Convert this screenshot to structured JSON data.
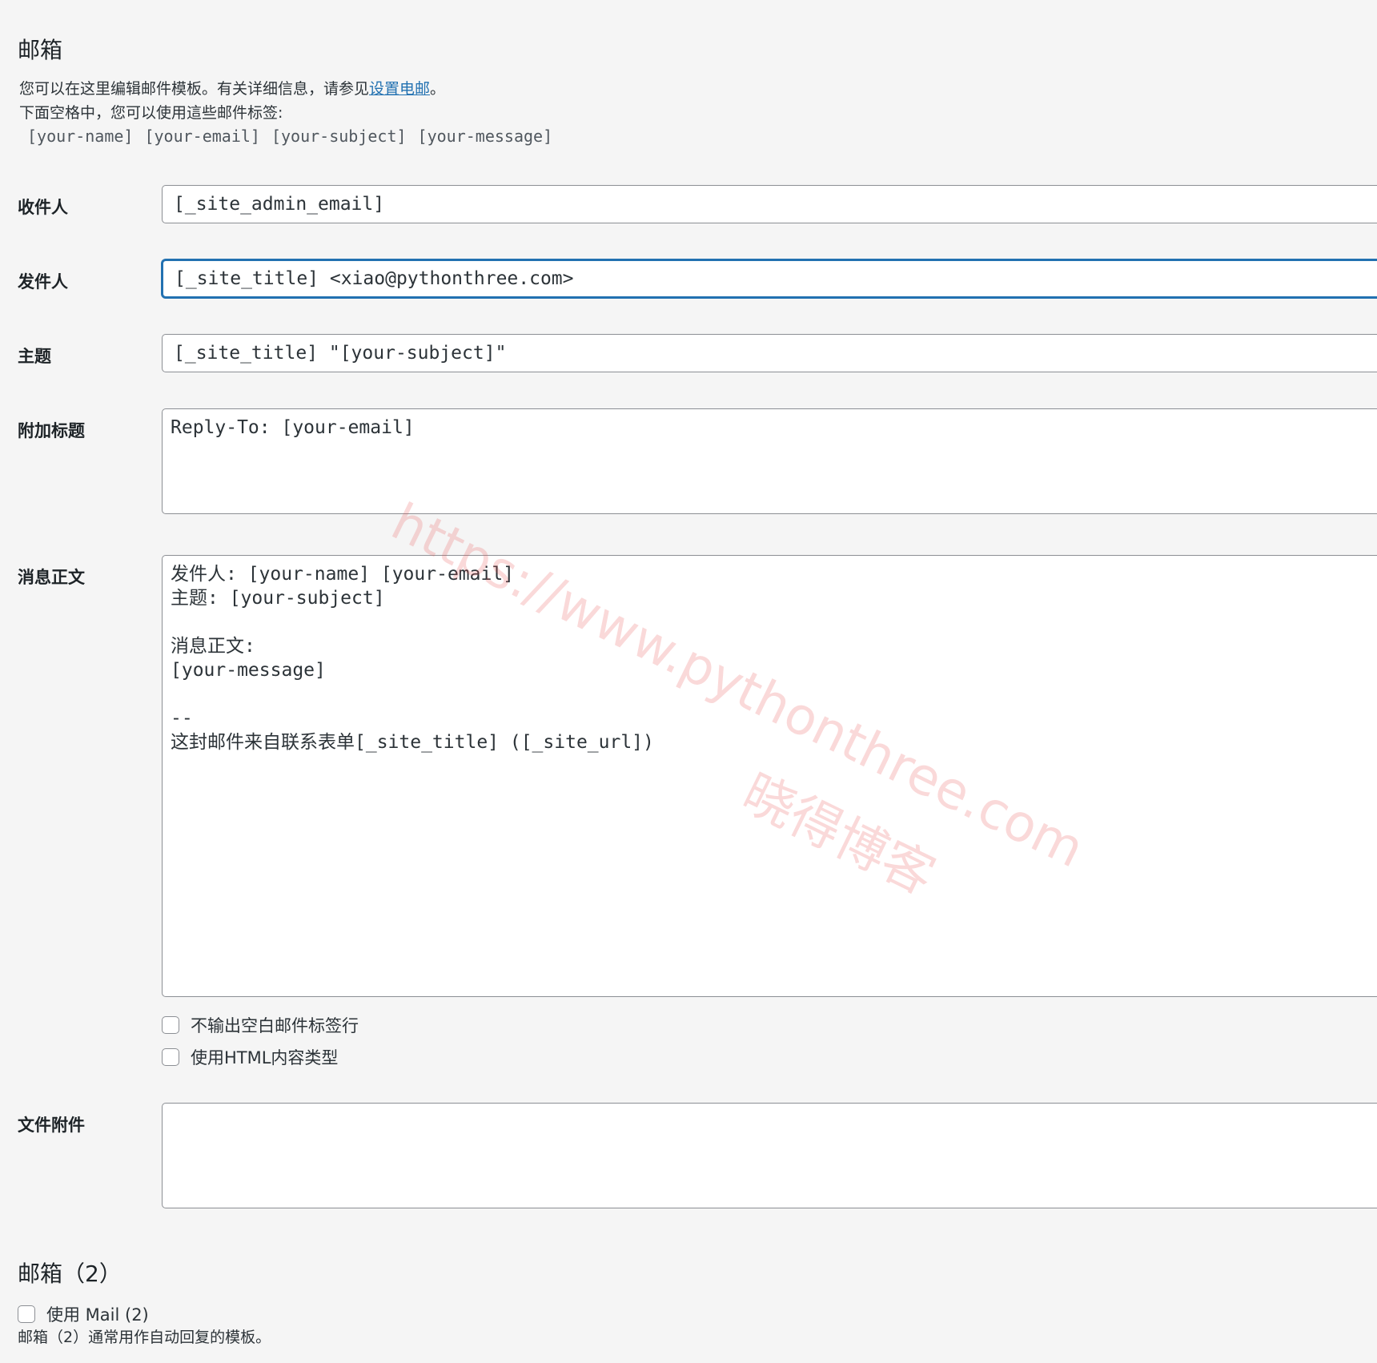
{
  "mail": {
    "title": "邮箱",
    "desc_prefix": "您可以在这里编辑邮件模板。有关详细信息，请参见",
    "desc_link": "设置电邮",
    "desc_suffix": "。",
    "desc_line2": "下面空格中，您可以使用這些邮件标签:",
    "tags": [
      "[your-name]",
      "[your-email]",
      "[your-subject]",
      "[your-message]"
    ],
    "fields": {
      "to": {
        "label": "收件人",
        "value": "[_site_admin_email]"
      },
      "from": {
        "label": "发件人",
        "value": "[_site_title] <xiao@pythonthree.com>"
      },
      "subject": {
        "label": "主题",
        "value": "[_site_title] \"[your-subject]\""
      },
      "headers": {
        "label": "附加标题",
        "value": "Reply-To: [your-email]"
      },
      "body": {
        "label": "消息正文",
        "value": "发件人: [your-name] [your-email]\n主题: [your-subject]\n\n消息正文:\n[your-message]\n\n--\n这封邮件来自联系表单[_site_title] ([_site_url])"
      },
      "attachments": {
        "label": "文件附件",
        "value": ""
      }
    },
    "options": {
      "exclude_blank": "不输出空白邮件标签行",
      "use_html": "使用HTML内容类型"
    }
  },
  "mail2": {
    "title": "邮箱（2）",
    "use_label": "使用 Mail (2)",
    "desc": "邮箱（2）通常用作自动回复的模板。"
  },
  "watermark": {
    "url": "https://www.pythonthree.com",
    "name": "晓得博客"
  }
}
